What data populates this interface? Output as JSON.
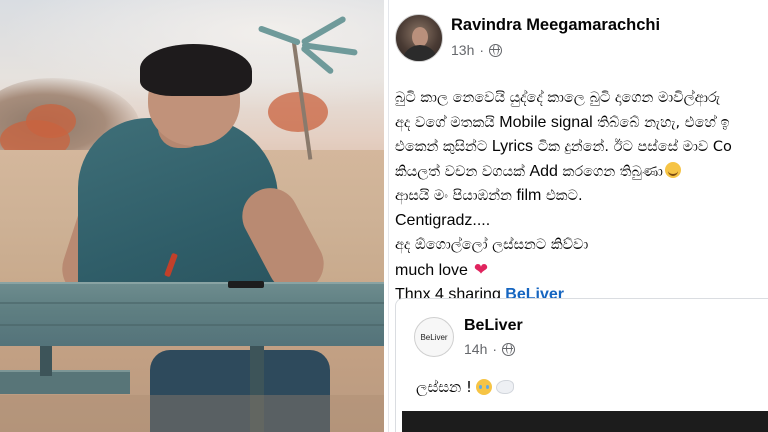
{
  "post": {
    "author": "Ravindra Meegamarachchi",
    "time": "13h",
    "separator": "·",
    "privacy_icon": "globe-icon",
    "lines": [
      {
        "a": "බුටි කාල නෙවෙයි යුද්දේ  කාලෙ බුටි දාගෙන මාවිල්ආරු",
        "b": "",
        "c": ""
      },
      {
        "a": "අද වගේ මතකයි ",
        "b": "Mobile signal",
        "c": "  තිබ්බේ නැහැ, එහේ ඉ"
      },
      {
        "a": "එකෙන් කුසින්ට ",
        "b": "Lyrics",
        "c": " ටික දුන්නේ. ඊට පස්සේ මාව Co"
      },
      {
        "a": "කියලත් වචන වගයක් ",
        "b": "Add",
        "c": "  කරගෙන තිබුණා"
      },
      {
        "a": "ආසයි මං පියාඹන්න ",
        "b": "film",
        "c": " එකට."
      },
      {
        "a": "",
        "b": "Centigradz....",
        "c": ""
      },
      {
        "a": "අද ඕගොල්ලෝ ලස්සනට කිව්වා",
        "b": "",
        "c": ""
      },
      {
        "a": "",
        "b": "much love",
        "c": ""
      },
      {
        "a": "",
        "b": "Thnx 4 sharing ",
        "c": ""
      }
    ],
    "mention": "BeLiver",
    "emoji_smile": "grinning-face-with-sweat-icon",
    "emoji_heart": "red-heart-icon"
  },
  "shared": {
    "avatar_text": "BeLiver",
    "author": "BeLiver",
    "time": "14h",
    "separator": "·",
    "text": "ලස්සන !",
    "emoji_1": "face-holding-back-tears-icon",
    "emoji_2": "dove-icon"
  },
  "colors": {
    "link": "#1565c0",
    "heart": "#e0245e",
    "meta": "#65676b"
  }
}
